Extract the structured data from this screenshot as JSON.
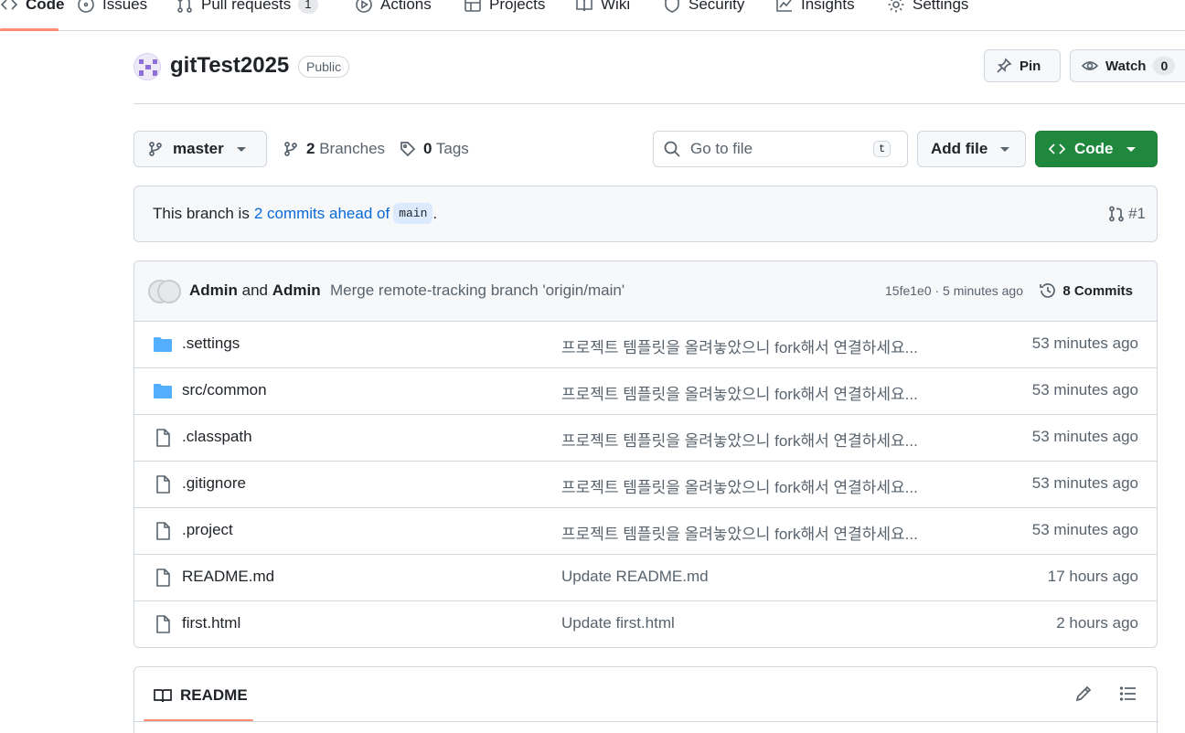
{
  "nav": {
    "items": [
      {
        "label": "Code",
        "icon": "code-icon",
        "active": true
      },
      {
        "label": "Issues",
        "icon": "issue-icon"
      },
      {
        "label": "Pull requests",
        "icon": "pull-request-icon",
        "count": "1"
      },
      {
        "label": "Actions",
        "icon": "play-icon"
      },
      {
        "label": "Projects",
        "icon": "table-icon"
      },
      {
        "label": "Wiki",
        "icon": "book-icon"
      },
      {
        "label": "Security",
        "icon": "shield-icon"
      },
      {
        "label": "Insights",
        "icon": "graph-icon"
      },
      {
        "label": "Settings",
        "icon": "gear-icon"
      }
    ]
  },
  "repo": {
    "name": "gitTest2025",
    "visibility": "Public",
    "pin_label": "Pin",
    "watch_label": "Watch",
    "watch_count": "0"
  },
  "toolbar": {
    "branch": "master",
    "branches_count": "2",
    "branches_label": "Branches",
    "tags_count": "0",
    "tags_label": "Tags",
    "search_placeholder": "Go to file",
    "search_shortcut": "t",
    "add_file_label": "Add file",
    "code_label": "Code"
  },
  "branch_info": {
    "prefix": "This branch is",
    "link_text": "2 commits ahead of",
    "base_branch": "main",
    "suffix": ".",
    "pr_ref": "#1"
  },
  "latest_commit": {
    "author1": "Admin",
    "conjunction": "and",
    "author2": "Admin",
    "message": "Merge remote-tracking branch 'origin/main'",
    "meta": "15fe1e0 · 5 minutes ago",
    "commits_label": "8 Commits"
  },
  "files": [
    {
      "name": ".settings",
      "type": "folder",
      "message": "프로젝트 템플릿을 올려놓았으니 fork해서 연결하세요...",
      "time": "53 minutes ago"
    },
    {
      "name": "src/common",
      "type": "folder",
      "message": "프로젝트 템플릿을 올려놓았으니 fork해서 연결하세요...",
      "time": "53 minutes ago"
    },
    {
      "name": ".classpath",
      "type": "file",
      "message": "프로젝트 템플릿을 올려놓았으니 fork해서 연결하세요...",
      "time": "53 minutes ago"
    },
    {
      "name": ".gitignore",
      "type": "file",
      "message": "프로젝트 템플릿을 올려놓았으니 fork해서 연결하세요...",
      "time": "53 minutes ago"
    },
    {
      "name": ".project",
      "type": "file",
      "message": "프로젝트 템플릿을 올려놓았으니 fork해서 연결하세요...",
      "time": "53 minutes ago"
    },
    {
      "name": "README.md",
      "type": "file",
      "message": "Update README.md",
      "time": "17 hours ago"
    },
    {
      "name": "first.html",
      "type": "file",
      "message": "Update first.html",
      "time": "2 hours ago"
    }
  ],
  "readme": {
    "tab_label": "README"
  },
  "colors": {
    "accent_underline": "#fd8c73",
    "primary_button": "#1f883d",
    "link": "#0969da",
    "folder": "#54aeff"
  }
}
